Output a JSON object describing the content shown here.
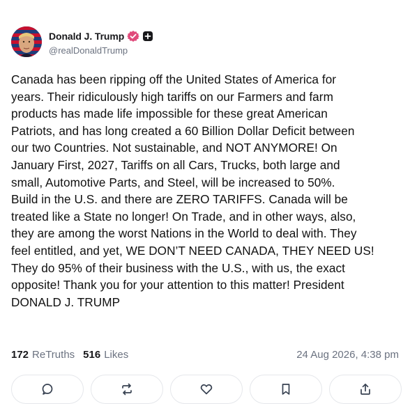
{
  "author": {
    "display_name": "Donald J. Trump",
    "handle": "@realDonaldTrump",
    "verified_icon": "verified-badge-icon",
    "follow_icon": "plus-box-icon"
  },
  "post": {
    "lines": [
      "Canada has been ripping off the United States of America for",
      "years. Their ridiculously high tariffs on our Farmers and farm",
      "products has made life impossible for these great American",
      "Patriots, and has long created a 60 Billion Dollar Deficit between",
      "our two Countries. Not sustainable, and NOT ANYMORE! On",
      "January First, 2027, Tariffs on all Cars, Trucks, both large and",
      "small, Automotive Parts, and Steel, will be increased to 50%.",
      "Build in the U.S. and there are ZERO TARIFFS. Canada will be",
      "treated like a State no longer! On Trade, and in other ways, also,",
      "they are among the worst Nations in the World to deal with. They",
      "feel entitled, and yet, WE DON’T NEED CANADA, THEY NEED US!",
      "They do 95% of their business with the U.S., with us, the exact",
      "opposite! Thank you for your attention to this matter! President",
      "DONALD J. TRUMP"
    ]
  },
  "stats": {
    "retruths_count": "172",
    "retruths_label": "ReTruths",
    "likes_count": "516",
    "likes_label": "Likes",
    "timestamp": "24 Aug 2026, 4:38 pm"
  },
  "actions": [
    {
      "name": "reply-button",
      "icon": "comment-icon"
    },
    {
      "name": "retruth-button",
      "icon": "repost-icon"
    },
    {
      "name": "like-button",
      "icon": "heart-icon"
    },
    {
      "name": "bookmark-button",
      "icon": "bookmark-icon"
    },
    {
      "name": "share-button",
      "icon": "share-icon"
    }
  ],
  "colors": {
    "verified": "#e0497a",
    "text": "#111111",
    "muted": "#6b7280",
    "border": "#e5e7eb",
    "icon": "#374151"
  }
}
